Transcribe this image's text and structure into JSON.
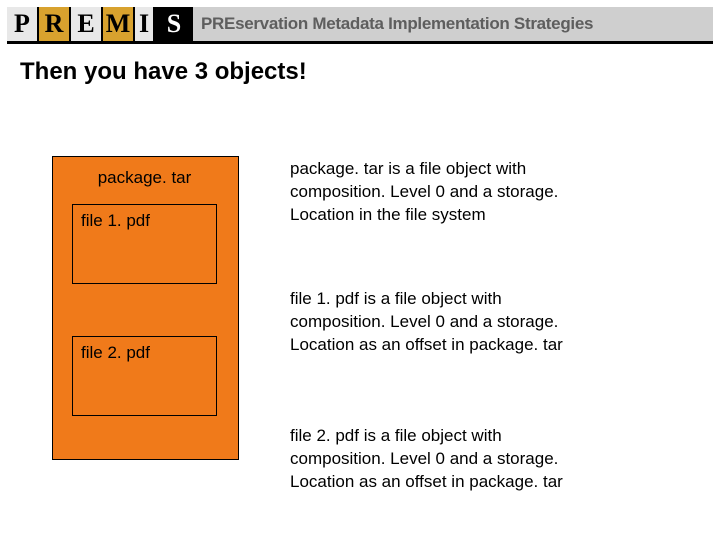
{
  "header": {
    "logo_letters": [
      "P",
      "R",
      "E",
      "M",
      "I",
      "S"
    ],
    "title_prefix": "PRE",
    "title_rest": "servation Metadata Implementation Strategies"
  },
  "heading": "Then you have 3 objects!",
  "package": {
    "label": "package. tar",
    "files": [
      "file 1. pdf",
      "file 2. pdf"
    ]
  },
  "descriptions": [
    "package. tar is a file object with composition. Level 0 and a storage. Location in the file system",
    "file 1. pdf is a file object with composition. Level 0 and a storage. Location as an offset in package. tar",
    "file 2. pdf is a file object with composition. Level 0 and a storage. Location as an offset in package. tar"
  ]
}
